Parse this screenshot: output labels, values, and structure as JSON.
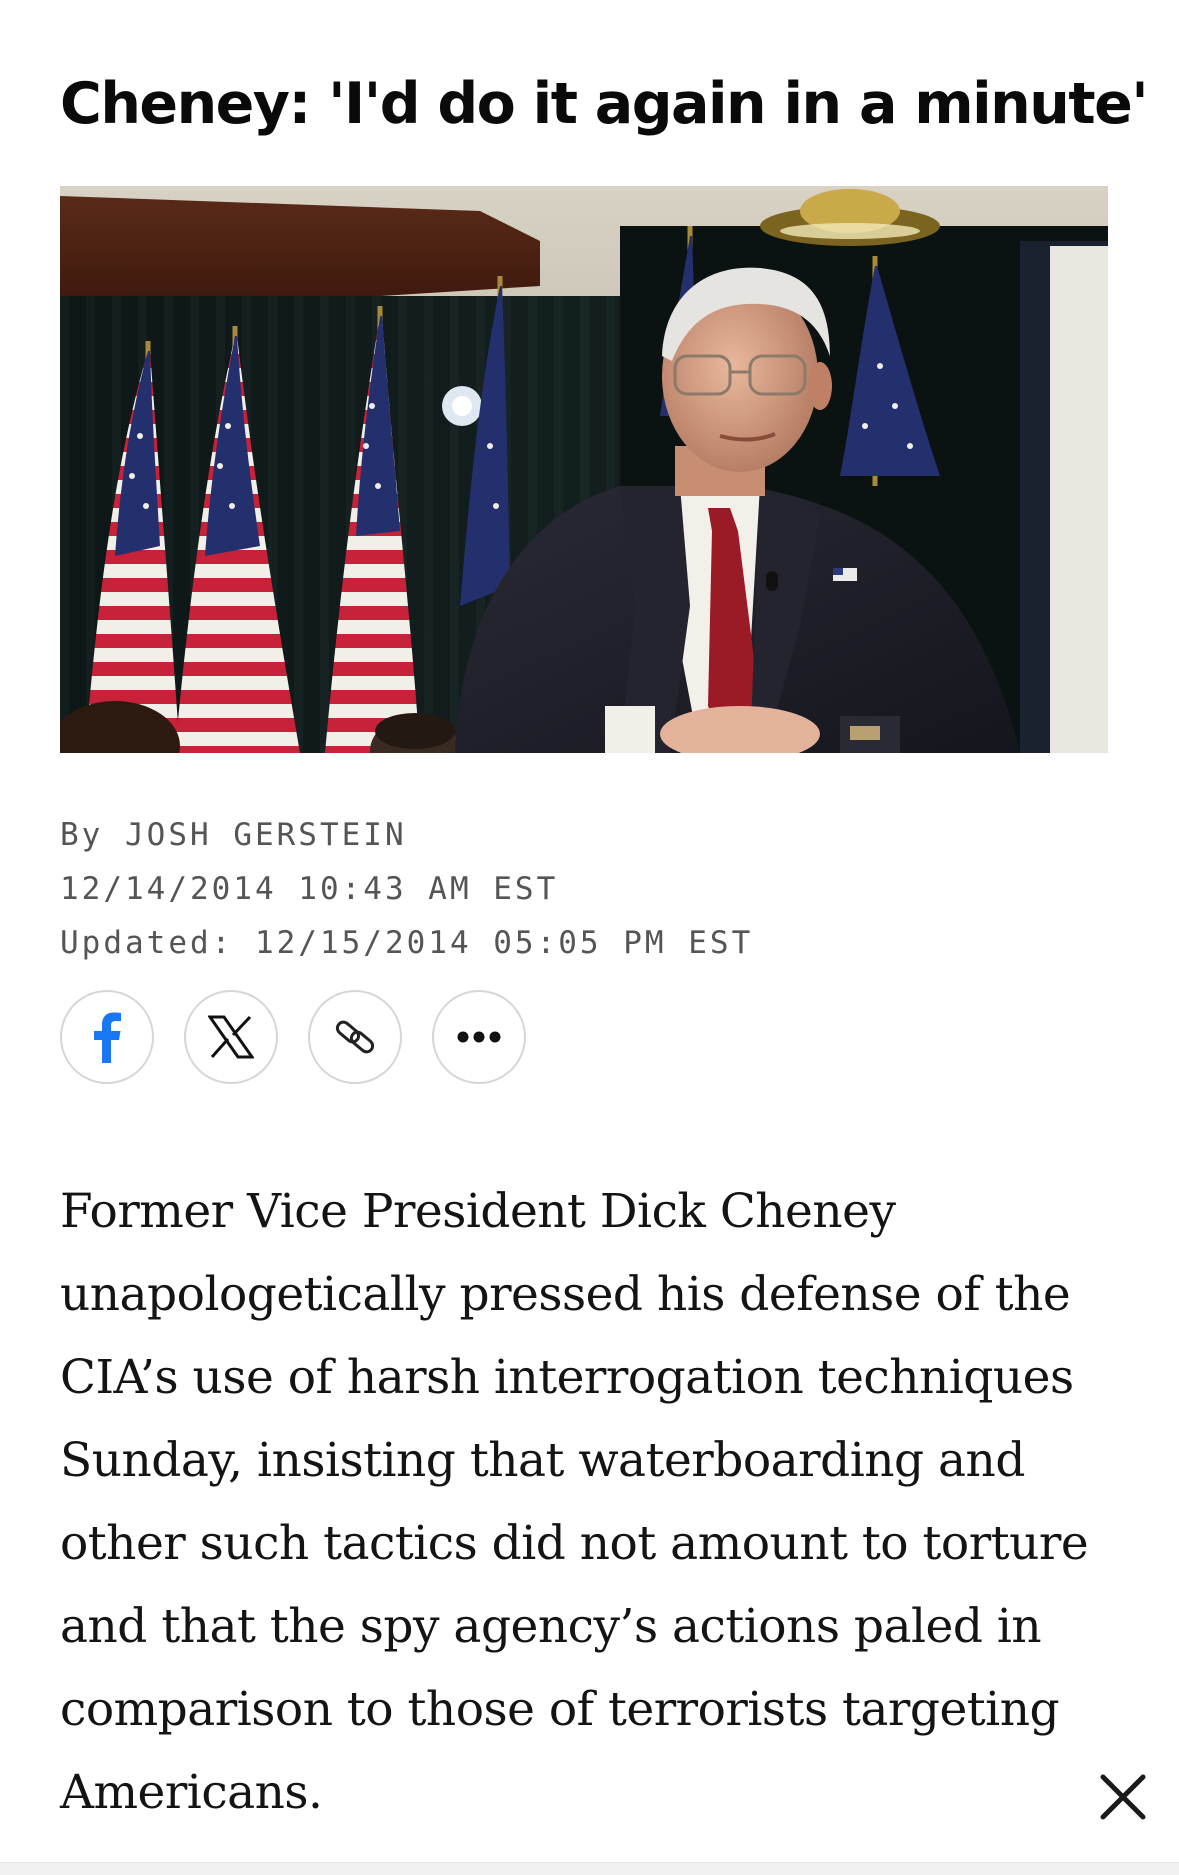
{
  "article": {
    "headline": "Cheney: 'I'd do it again in a minute'",
    "byline_prefix": "By ",
    "author": "JOSH GERSTEIN",
    "published": "12/14/2014 10:43 AM EST",
    "updated": "Updated: 12/15/2014 05:05 PM EST",
    "body": "Former Vice President Dick Cheney unapologetically pressed his defense of the CIA’s use of harsh interrogation techniques Sunday, insisting that waterboarding and other such tactics did not amount to torture and that the spy agency’s actions paled in comparison to those of terrorists targeting Americans."
  },
  "share": {
    "buttons": [
      {
        "id": "facebook",
        "icon": "facebook-icon"
      },
      {
        "id": "x",
        "icon": "x-logo-icon"
      },
      {
        "id": "copy-link",
        "icon": "link-icon"
      },
      {
        "id": "more",
        "icon": "more-horizontal-icon"
      }
    ]
  },
  "overlay": {
    "close_icon": "close-icon"
  },
  "colors": {
    "facebook_blue": "#1877f2",
    "text": "#141414",
    "meta_gray": "#555555",
    "button_border": "#d6d6d6"
  }
}
